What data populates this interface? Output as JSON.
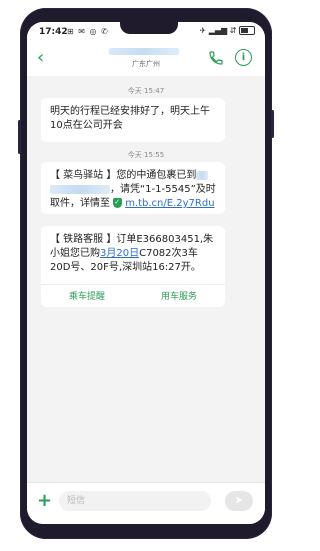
{
  "status": {
    "time": "17:42",
    "left_icons": "⊞ ✉ ◎ ✆",
    "right_icons": "✈ ▂▄▆ ⇵"
  },
  "header": {
    "back_icon": "chevron-left",
    "contact_location": "广东广州",
    "phone_icon": "phone",
    "info_icon": "info",
    "info_glyph": "i",
    "accent": "#2a9d57"
  },
  "messages": [
    {
      "timestamp": "今天 15:47",
      "text": "明天的行程已经安排好了，明天上午10点在公司开会"
    },
    {
      "timestamp": "今天 15:55",
      "prefix": "【 菜鸟驿站 】您的中通包裹已到",
      "middle": "，请凭“1-1-5545”及时取件，详情至",
      "link": "m.tb.cn/E.2y7Rdu"
    },
    {
      "pre": "【 铁路客服 】订单E366803451,朱小姐您已购",
      "date_link": "3月20日",
      "post": "C7082次3车20D号、20F号,深圳站16:27开。",
      "actions": [
        "乘车提醒",
        "用车服务"
      ]
    }
  ],
  "input": {
    "placeholder": "短信",
    "plus_icon": "+",
    "send_icon": "➤"
  }
}
